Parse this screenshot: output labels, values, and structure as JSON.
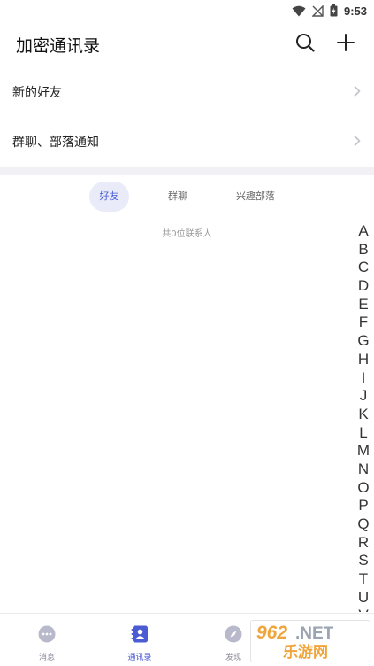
{
  "status_bar": {
    "time": "9:53"
  },
  "header": {
    "title": "加密通讯录"
  },
  "menu": [
    {
      "label": "新的好友"
    },
    {
      "label": "群聊、部落通知"
    }
  ],
  "tabs": [
    {
      "label": "好友",
      "active": true
    },
    {
      "label": "群聊",
      "active": false
    },
    {
      "label": "兴趣部落",
      "active": false
    }
  ],
  "contact_count": "共0位联系人",
  "alphabet": [
    "A",
    "B",
    "C",
    "D",
    "E",
    "F",
    "G",
    "H",
    "I",
    "J",
    "K",
    "L",
    "M",
    "N",
    "O",
    "P",
    "Q",
    "R",
    "S",
    "T",
    "U",
    "V"
  ],
  "bottom_nav": [
    {
      "label": "消息",
      "icon": "chat-bubble-icon",
      "active": false
    },
    {
      "label": "通讯录",
      "icon": "contacts-book-icon",
      "active": true
    },
    {
      "label": "发现",
      "icon": "compass-icon",
      "active": false
    },
    {
      "label": "",
      "icon": "",
      "active": false
    }
  ],
  "watermark": {
    "text_top": "962.NET",
    "text_bottom": "乐游网"
  },
  "colors": {
    "accent": "#4a5bd4",
    "active_tab_bg": "#e9ecf8",
    "divider": "#f0f0f5",
    "inactive_icon": "#b8bacb"
  }
}
